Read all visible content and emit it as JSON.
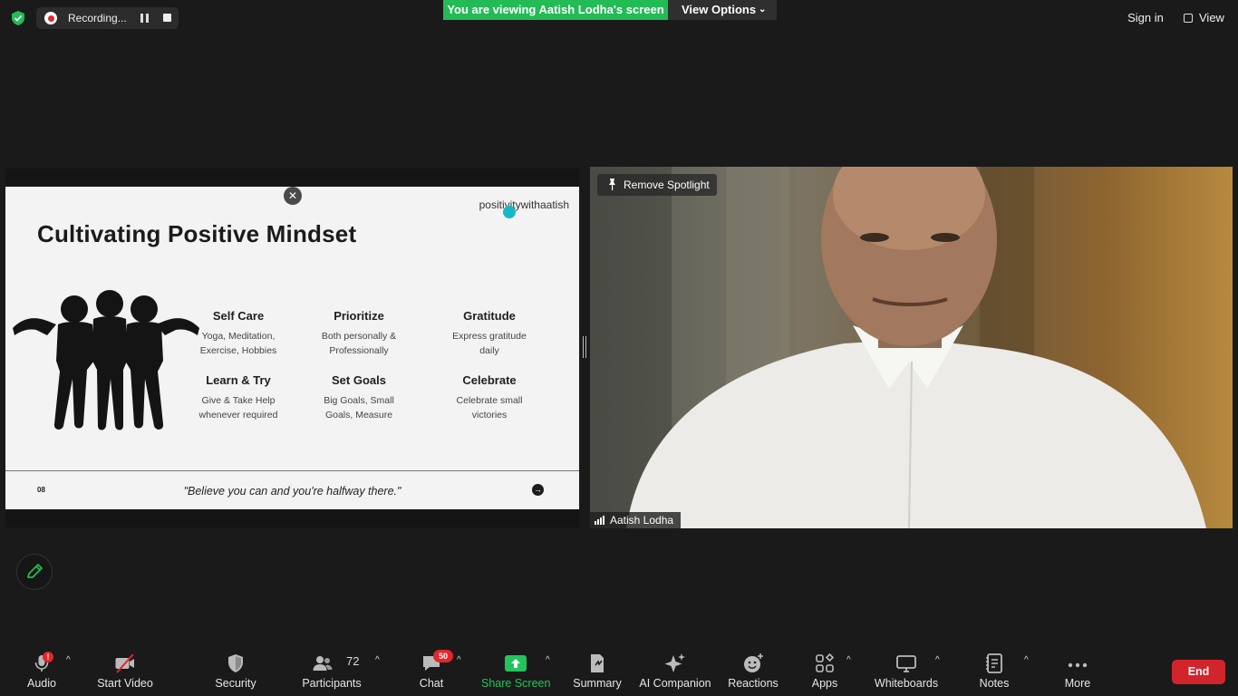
{
  "topbar": {
    "recording_label": "Recording...",
    "viewing_banner": "You are viewing Aatish Lodha's screen",
    "view_options_label": "View Options",
    "sign_in_label": "Sign in",
    "view_label": "View"
  },
  "share": {
    "slide": {
      "brand": "positivitywithaatish",
      "title": "Cultivating Positive Mindset",
      "features": [
        {
          "heading": "Self Care",
          "line1": "Yoga, Meditation,",
          "line2": "Exercise, Hobbies"
        },
        {
          "heading": "Prioritize",
          "line1": "Both personally &",
          "line2": "Professionally"
        },
        {
          "heading": "Gratitude",
          "line1": "Express gratitude",
          "line2": "daily"
        },
        {
          "heading": "Learn & Try",
          "line1": "Give & Take Help",
          "line2": "whenever required"
        },
        {
          "heading": "Set Goals",
          "line1": "Big Goals, Small",
          "line2": "Goals, Measure"
        },
        {
          "heading": "Celebrate",
          "line1": "Celebrate small",
          "line2": "victories"
        }
      ],
      "slide_number": "08",
      "quote": "\"Believe you can and you're halfway there.\""
    }
  },
  "video": {
    "spotlight_label": "Remove Spotlight",
    "participant_name": "Aatish Lodha"
  },
  "toolbar": {
    "audio": "Audio",
    "start_video": "Start Video",
    "security": "Security",
    "participants": "Participants",
    "participants_count": "72",
    "chat": "Chat",
    "chat_badge": "50",
    "share_screen": "Share Screen",
    "summary": "Summary",
    "ai_companion": "AI Companion",
    "reactions": "Reactions",
    "apps": "Apps",
    "whiteboards": "Whiteboards",
    "notes": "Notes",
    "more": "More",
    "end": "End",
    "audio_badge": "!"
  },
  "colors": {
    "background": "#1a1a1a",
    "banner_green": "#22bb55",
    "share_green": "#23c45e",
    "end_red": "#d1242b",
    "badge_red": "#e3262b",
    "cursor_teal": "#18b8c8"
  }
}
